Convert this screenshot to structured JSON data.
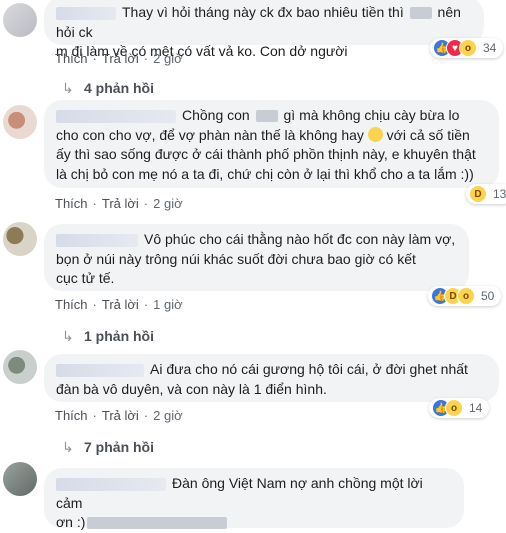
{
  "comments": [
    {
      "lines": [
        "Thay vì hỏi tháng này ck đx bao nhiêu tiền thì ",
        " nên hỏi ck",
        "m đi làm về có mệt có vất vả ko. Con dở người"
      ],
      "actions": {
        "like": "Thích",
        "reply": "Trả lời",
        "time": "2 giờ"
      },
      "reaction_count": "34",
      "reactions": [
        "like-icon",
        "love-icon",
        "wow-icon"
      ]
    },
    {
      "lines": [
        "Chồng con ",
        " gì mà không chịu cày bừa lo",
        "cho con cho vợ, để vợ phàn nàn thế là không hay ",
        " với cả số tiền",
        "ấy thì sao sống được ở cái thành phố phồn thịnh này, e khuyên thật",
        "là chị bỏ con mẹ nó a ta đi, chứ chị còn ở lại thì khổ cho a ta lắm :))"
      ],
      "actions": {
        "like": "Thích",
        "reply": "Trả lời",
        "time": "2 giờ"
      },
      "reaction_count": "13",
      "reactions": [
        "haha-icon"
      ]
    },
    {
      "lines": [
        "Vô phúc cho cái thằng nào hốt đc con này làm vợ,",
        "bọn ở núi này trông núi khác suốt đời chưa bao giờ có kết",
        "cục tử tế."
      ],
      "actions": {
        "like": "Thích",
        "reply": "Trả lời",
        "time": "1 giờ"
      },
      "reaction_count": "50",
      "reactions": [
        "like-icon",
        "haha-icon",
        "wow-icon"
      ]
    },
    {
      "lines": [
        "Ai đưa cho nó cái gương hộ tôi cái, ở đời ghet nhất",
        "đàn bà vô duyên, và con này là 1 điển hình."
      ],
      "actions": {
        "like": "Thích",
        "reply": "Trả lời",
        "time": "2 giờ"
      },
      "reaction_count": "14",
      "reactions": [
        "like-icon",
        "wow-icon"
      ]
    },
    {
      "lines": [
        "Đàn ông Việt Nam nợ anh chồng một lời cảm",
        "ơn :)"
      ]
    }
  ],
  "reply_links": [
    "4 phản hồi",
    "1 phản hồi",
    "7 phản hồi"
  ],
  "icons": {
    "reply_arrow": "reply-arrow-icon",
    "sad_emoji": "sad-emoji-icon"
  },
  "colors": {
    "bubble": "#f2f3f5",
    "like": "#3578e5",
    "love": "#f0284a",
    "wow": "#fcd34d"
  }
}
